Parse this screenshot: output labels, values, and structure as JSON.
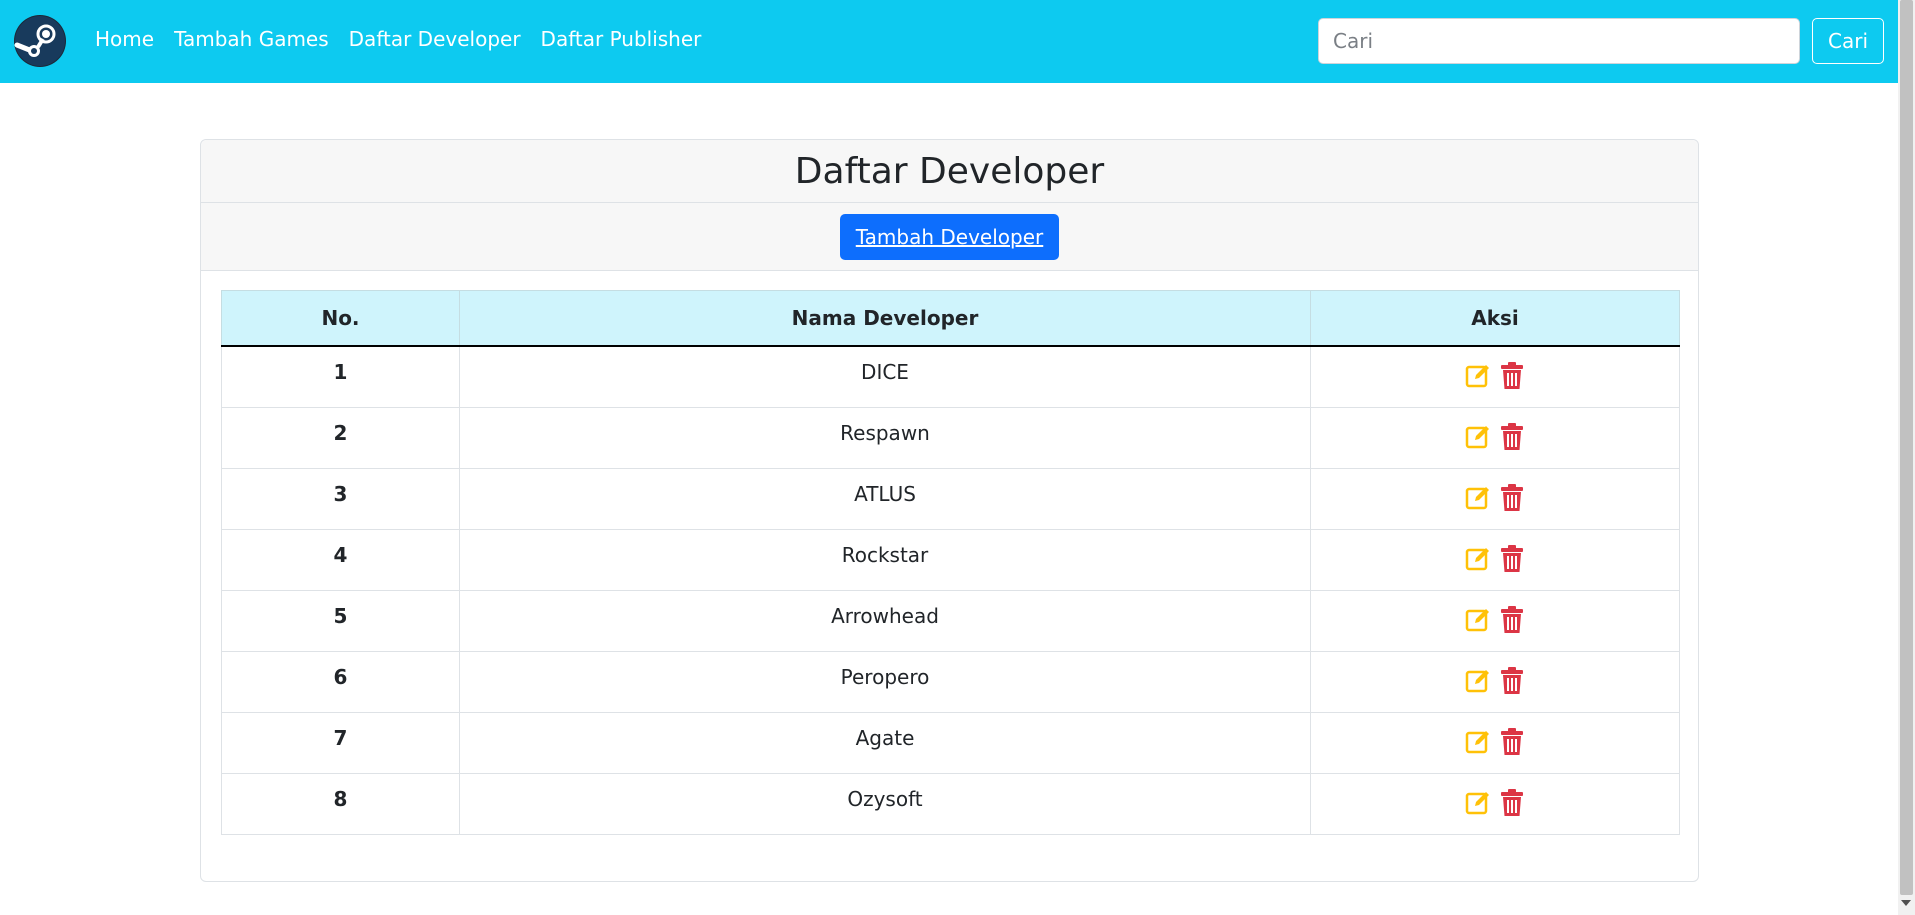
{
  "navbar": {
    "logo_icon": "steam-logo-icon",
    "links": [
      "Home",
      "Tambah Games",
      "Daftar Developer",
      "Daftar Publisher"
    ],
    "search_placeholder": "Cari",
    "search_button": "Cari",
    "background_color": "#0dcaf0"
  },
  "card": {
    "title": "Daftar Developer",
    "add_button": "Tambah Developer",
    "add_button_color": "#0d6efd"
  },
  "table": {
    "headers": [
      "No.",
      "Nama Developer",
      "Aksi"
    ],
    "rows": [
      {
        "no": "1",
        "name": "DICE"
      },
      {
        "no": "2",
        "name": "Respawn"
      },
      {
        "no": "3",
        "name": "ATLUS"
      },
      {
        "no": "4",
        "name": "Rockstar"
      },
      {
        "no": "5",
        "name": "Arrowhead"
      },
      {
        "no": "6",
        "name": "Peropero"
      },
      {
        "no": "7",
        "name": "Agate"
      },
      {
        "no": "8",
        "name": "Ozysoft"
      }
    ],
    "edit_icon": "edit-icon",
    "delete_icon": "trash-icon",
    "edit_color": "#ffc107",
    "delete_color": "#dc3545"
  }
}
